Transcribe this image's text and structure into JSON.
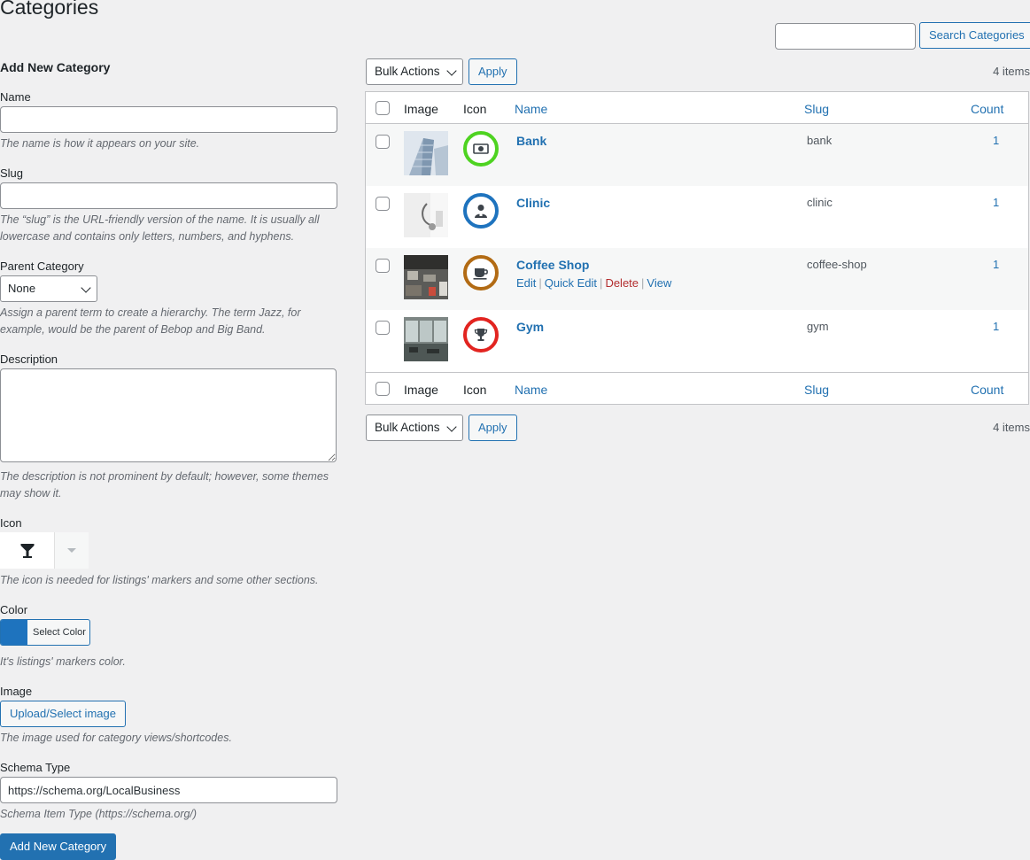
{
  "page": {
    "title": "Categories"
  },
  "form": {
    "heading": "Add New Category",
    "name": {
      "label": "Name",
      "value": "",
      "hint": "The name is how it appears on your site."
    },
    "slug": {
      "label": "Slug",
      "value": "",
      "hint_line1": "The “slug” is the URL-friendly version of the name. It is usually all",
      "hint_line2": "lowercase and contains only letters, numbers, and hyphens."
    },
    "parent": {
      "label": "Parent Category",
      "selected": "None",
      "hint_line1": "Assign a parent term to create a hierarchy. The term Jazz, for",
      "hint_line2": "example, would be the parent of Bebop and Big Band."
    },
    "description": {
      "label": "Description",
      "value": "",
      "hint_line1": "The description is not prominent by default; however, some themes",
      "hint_line2": "may show it."
    },
    "icon": {
      "label": "Icon",
      "selected_icon": "cocktail-icon",
      "hint": "The icon is needed for listings' markers and some other sections."
    },
    "color": {
      "label": "Color",
      "button_label": "Select Color",
      "value": "#1e73be",
      "hint": "It's listings' markers color."
    },
    "image": {
      "label": "Image",
      "button_label": "Upload/Select image",
      "hint": "The image used for category views/shortcodes."
    },
    "schema": {
      "label": "Schema Type",
      "value": "https://schema.org/LocalBusiness",
      "hint": "Schema Item Type (https://schema.org/)"
    },
    "submit_label": "Add New Category"
  },
  "search": {
    "value": "",
    "button_label": "Search Categories"
  },
  "bulk": {
    "top_label": "Bulk Actions",
    "bottom_label": "Bulk Actions",
    "apply_label": "Apply",
    "items_count": "4 items"
  },
  "table": {
    "columns": {
      "image": "Image",
      "icon": "Icon",
      "name": "Name",
      "slug": "Slug",
      "count": "Count"
    },
    "rows": [
      {
        "name": "Bank",
        "slug": "bank",
        "count": "1",
        "icon": "money-icon",
        "ring_color": "#4ed321",
        "image": "office-tower-photo"
      },
      {
        "name": "Clinic",
        "slug": "clinic",
        "count": "1",
        "icon": "doctor-icon",
        "ring_color": "#1e73be",
        "image": "stethoscope-photo"
      },
      {
        "name": "Coffee Shop",
        "slug": "coffee-shop",
        "count": "1",
        "icon": "coffee-icon",
        "ring_color": "#b26b14",
        "image": "cafe-interior-photo",
        "actions": {
          "edit": "Edit",
          "quick_edit": "Quick Edit",
          "delete": "Delete",
          "view": "View"
        }
      },
      {
        "name": "Gym",
        "slug": "gym",
        "count": "1",
        "icon": "trophy-icon",
        "ring_color": "#e22420",
        "image": "gym-interior-photo"
      }
    ]
  }
}
